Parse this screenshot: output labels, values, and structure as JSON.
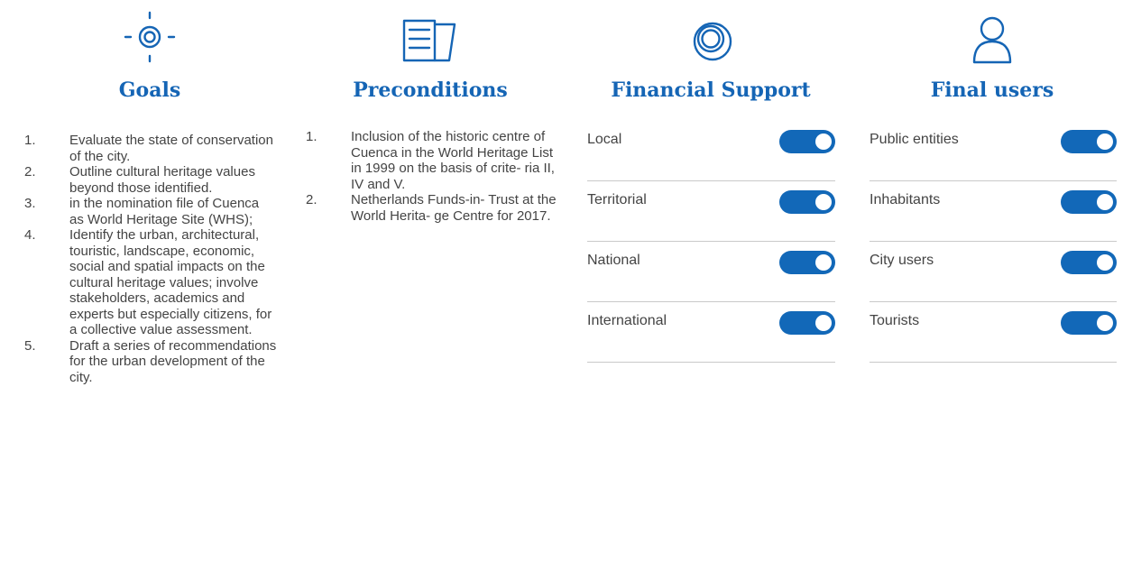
{
  "goals": {
    "title": "Goals",
    "icon": "target-icon",
    "items": [
      {
        "num": "1.",
        "text": "Evaluate the state of conservation of the city."
      },
      {
        "num": "2.",
        "text": "Outline cultural heritage values beyond those identified."
      },
      {
        "num": "3.",
        "text": "in the nomination file of Cuenca as World Heritage Site (WHS);"
      },
      {
        "num": "4.",
        "text": "Identify the urban, architectural, touristic, landscape, economic, social and spatial impacts on the cultural heritage values; involve stakeholders, academics and experts but especially citizens, for a collective value assessment."
      },
      {
        "num": "5.",
        "text": "Draft a series of recommendations for the urban development of the city."
      }
    ]
  },
  "preconditions": {
    "title": "Preconditions",
    "icon": "document-icon",
    "items": [
      {
        "num": "1.",
        "text": "Inclusion of the historic centre of Cuenca in the World Heritage List in 1999 on the basis of crite- ria II, IV and V."
      },
      {
        "num": "2.",
        "text": "Netherlands Funds-in- Trust at the World Herita- ge Centre for 2017."
      }
    ]
  },
  "financial_support": {
    "title": "Financial Support",
    "icon": "coins-icon",
    "items": [
      {
        "label": "Local",
        "on": true
      },
      {
        "label": "Territorial",
        "on": true
      },
      {
        "label": "National",
        "on": true
      },
      {
        "label": "International",
        "on": true
      }
    ]
  },
  "final_users": {
    "title": "Final users",
    "icon": "user-icon",
    "items": [
      {
        "label": "Public entities",
        "on": true
      },
      {
        "label": "Inhabitants",
        "on": true
      },
      {
        "label": "City users",
        "on": true
      },
      {
        "label": "Tourists",
        "on": true
      }
    ]
  },
  "colors": {
    "accent": "#1565b5",
    "toggle_on": "#1268b8",
    "text": "#444444",
    "divider": "#c9c9c9"
  }
}
